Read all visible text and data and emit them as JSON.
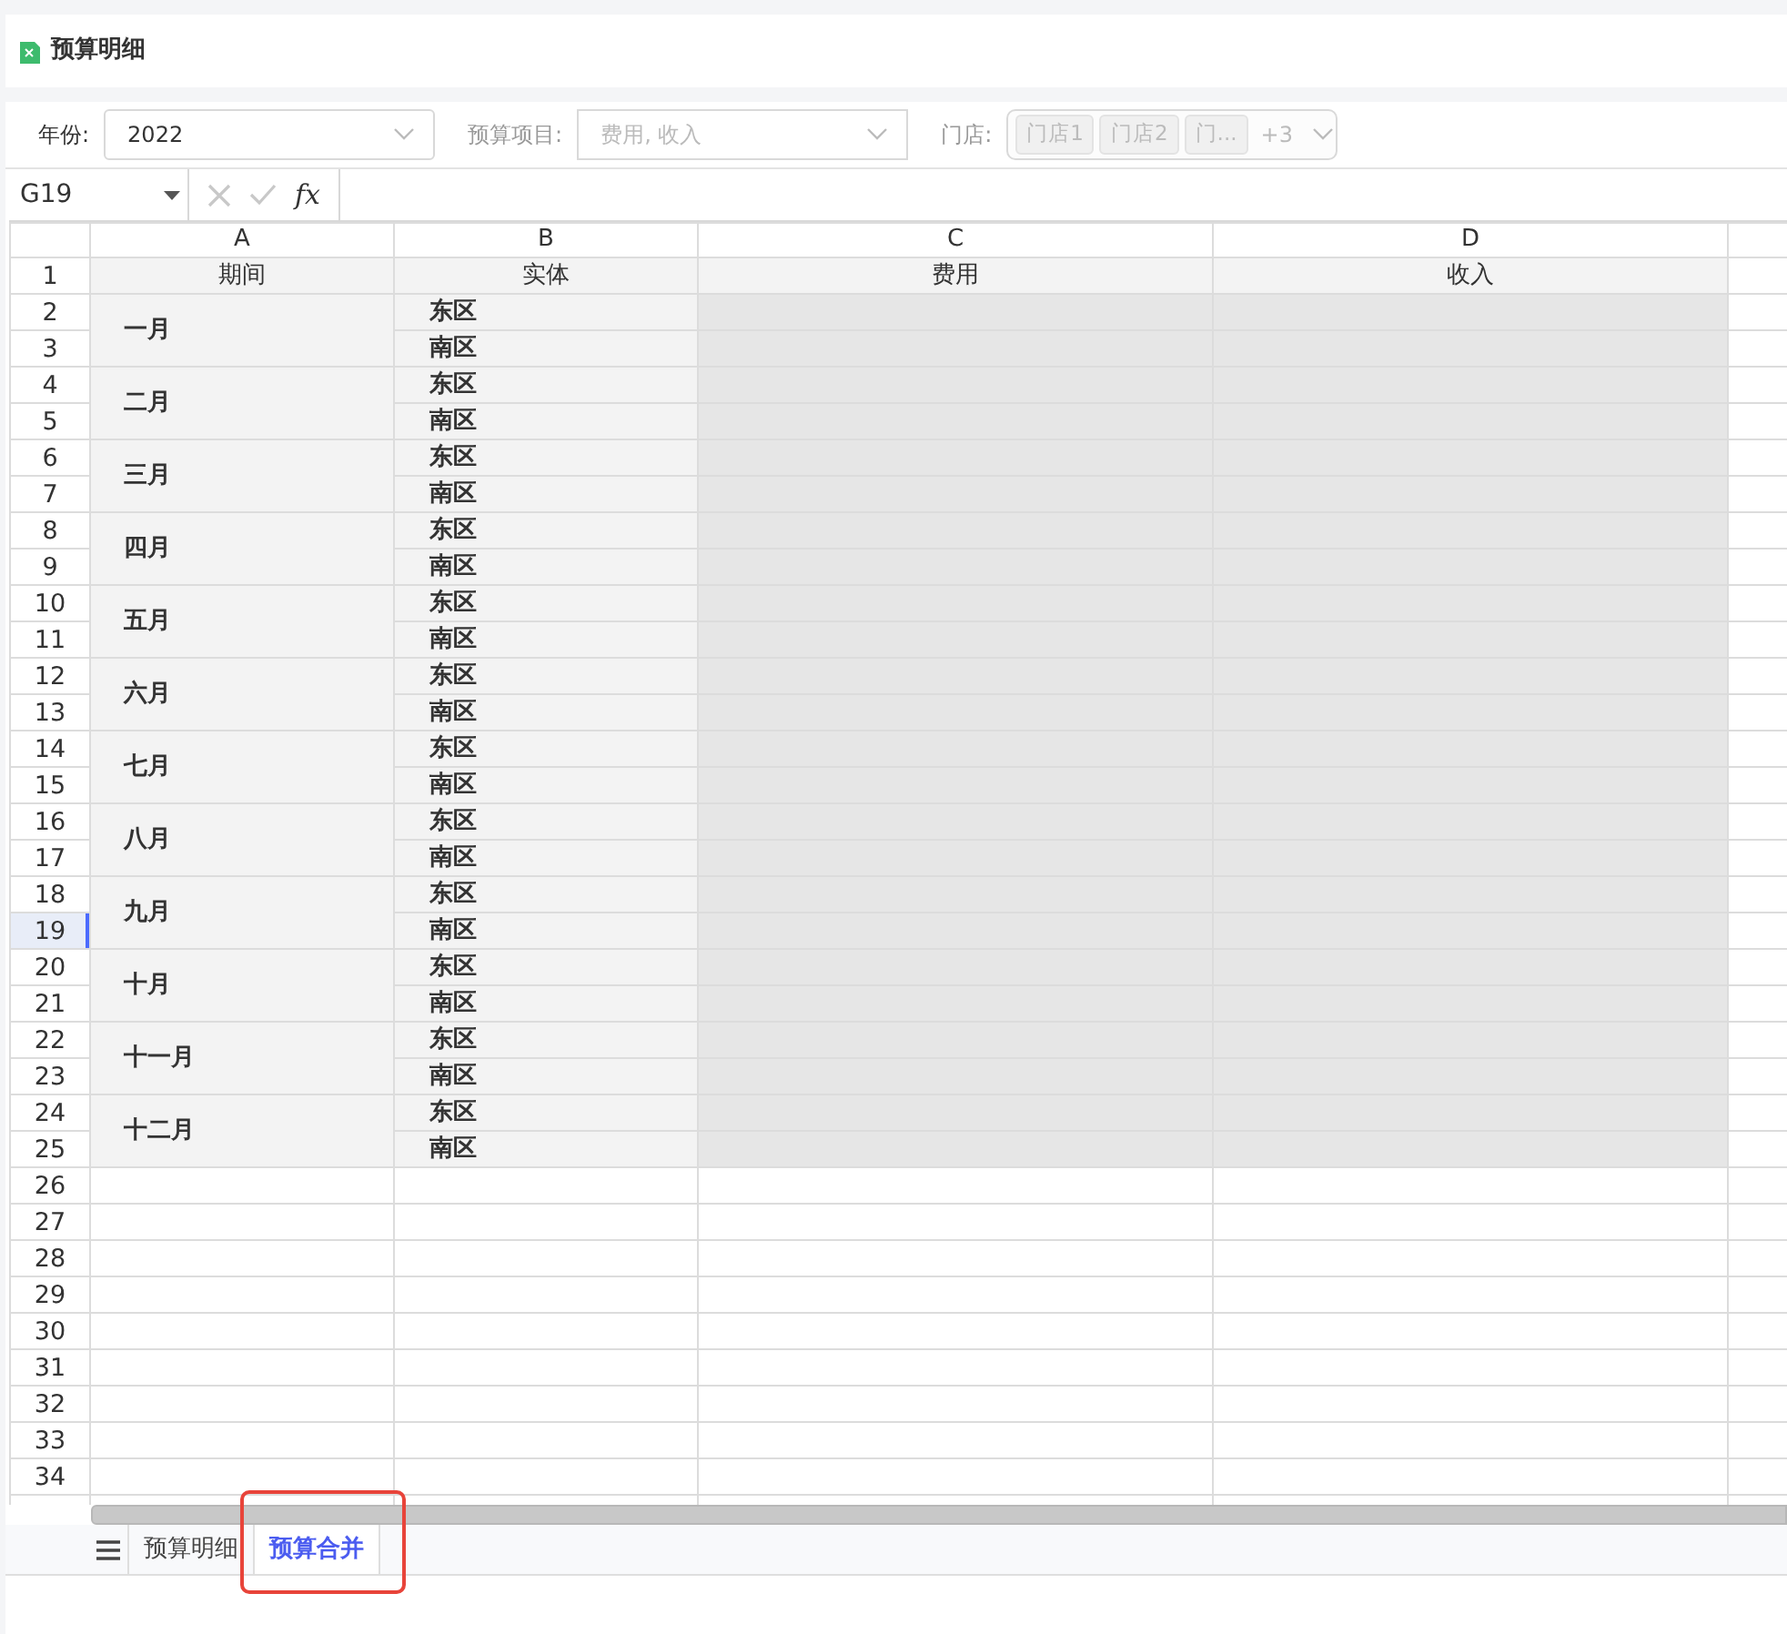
{
  "title": "预算明细",
  "filters": [
    {
      "kind": "select",
      "label": "年份:",
      "value": "2022",
      "disabled": false
    },
    {
      "kind": "select",
      "label": "预算项目:",
      "placeholder": "费用, 收入",
      "disabled": true
    },
    {
      "kind": "tags",
      "label": "门店:",
      "tags": [
        "门店1",
        "门店2",
        "门..."
      ],
      "more": "+3",
      "disabled": true
    }
  ],
  "formula_bar": {
    "cell_ref": "G19",
    "fx": "fx"
  },
  "columns": [
    "A",
    "B",
    "C",
    "D"
  ],
  "header_row": {
    "number": "1",
    "cells": [
      "期间",
      "实体",
      "费用",
      "收入"
    ]
  },
  "groups": [
    {
      "period": "一月",
      "rows": [
        {
          "number": "2",
          "entity": "东区",
          "selected": false
        },
        {
          "number": "3",
          "entity": "南区",
          "selected": false
        }
      ]
    },
    {
      "period": "二月",
      "rows": [
        {
          "number": "4",
          "entity": "东区",
          "selected": false
        },
        {
          "number": "5",
          "entity": "南区",
          "selected": false
        }
      ]
    },
    {
      "period": "三月",
      "rows": [
        {
          "number": "6",
          "entity": "东区",
          "selected": false
        },
        {
          "number": "7",
          "entity": "南区",
          "selected": false
        }
      ]
    },
    {
      "period": "四月",
      "rows": [
        {
          "number": "8",
          "entity": "东区",
          "selected": false
        },
        {
          "number": "9",
          "entity": "南区",
          "selected": false
        }
      ]
    },
    {
      "period": "五月",
      "rows": [
        {
          "number": "10",
          "entity": "东区",
          "selected": false
        },
        {
          "number": "11",
          "entity": "南区",
          "selected": false
        }
      ]
    },
    {
      "period": "六月",
      "rows": [
        {
          "number": "12",
          "entity": "东区",
          "selected": false
        },
        {
          "number": "13",
          "entity": "南区",
          "selected": false
        }
      ]
    },
    {
      "period": "七月",
      "rows": [
        {
          "number": "14",
          "entity": "东区",
          "selected": false
        },
        {
          "number": "15",
          "entity": "南区",
          "selected": false
        }
      ]
    },
    {
      "period": "八月",
      "rows": [
        {
          "number": "16",
          "entity": "东区",
          "selected": false
        },
        {
          "number": "17",
          "entity": "南区",
          "selected": false
        }
      ]
    },
    {
      "period": "九月",
      "rows": [
        {
          "number": "18",
          "entity": "东区",
          "selected": false
        },
        {
          "number": "19",
          "entity": "南区",
          "selected": true
        }
      ]
    },
    {
      "period": "十月",
      "rows": [
        {
          "number": "20",
          "entity": "东区",
          "selected": false
        },
        {
          "number": "21",
          "entity": "南区",
          "selected": false
        }
      ]
    },
    {
      "period": "十一月",
      "rows": [
        {
          "number": "22",
          "entity": "东区",
          "selected": false
        },
        {
          "number": "23",
          "entity": "南区",
          "selected": false
        }
      ]
    },
    {
      "period": "十二月",
      "rows": [
        {
          "number": "24",
          "entity": "东区",
          "selected": false
        },
        {
          "number": "25",
          "entity": "南区",
          "selected": false
        }
      ]
    }
  ],
  "empty_rows": [
    {
      "number": "26",
      "selected": false
    },
    {
      "number": "27",
      "selected": false
    },
    {
      "number": "28",
      "selected": false
    },
    {
      "number": "29",
      "selected": false
    },
    {
      "number": "30",
      "selected": false
    },
    {
      "number": "31",
      "selected": false
    },
    {
      "number": "32",
      "selected": false
    },
    {
      "number": "33",
      "selected": false
    },
    {
      "number": "34",
      "selected": false
    }
  ],
  "sheet_tabs": [
    {
      "label": "预算明细",
      "selected": false,
      "highlighted": false
    },
    {
      "label": "预算合并",
      "selected": true,
      "highlighted": true
    }
  ]
}
